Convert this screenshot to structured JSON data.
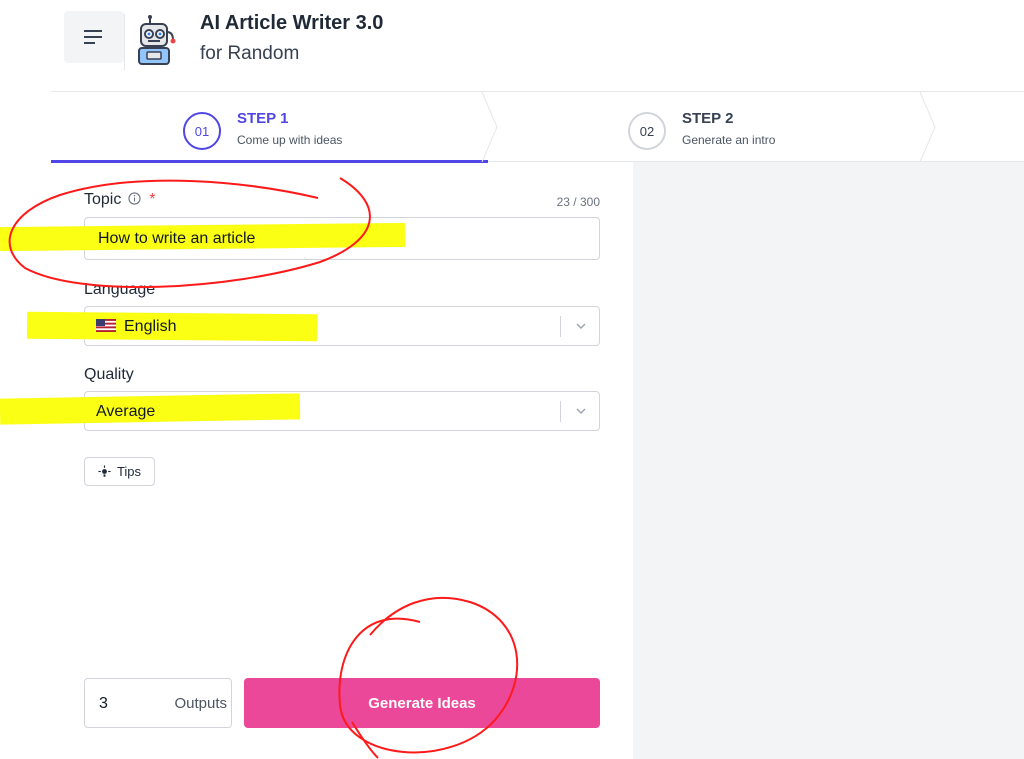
{
  "header": {
    "title": "AI Article Writer 3.0",
    "subtitle": "for Random"
  },
  "steps": [
    {
      "number": "01",
      "title": "STEP 1",
      "description": "Come up with ideas"
    },
    {
      "number": "02",
      "title": "STEP 2",
      "description": "Generate an intro"
    }
  ],
  "form": {
    "topic": {
      "label": "Topic",
      "required_mark": "*",
      "char_count": "23 / 300",
      "value": "How to write an article"
    },
    "language": {
      "label": "Language",
      "value": "English"
    },
    "quality": {
      "label": "Quality",
      "value": "Average"
    },
    "tips_label": "Tips",
    "outputs": {
      "value": "3",
      "label": "Outputs"
    },
    "generate_label": "Generate Ideas"
  },
  "colors": {
    "accent": "#4f46e5",
    "generate_button": "#ec4899",
    "highlighter": "#fbff14",
    "annotation_pen": "#ff1a1a"
  },
  "icons": [
    "menu-icon",
    "robot-icon",
    "info-icon",
    "us-flag-icon",
    "chevron-down-icon",
    "lightbulb-icon"
  ]
}
